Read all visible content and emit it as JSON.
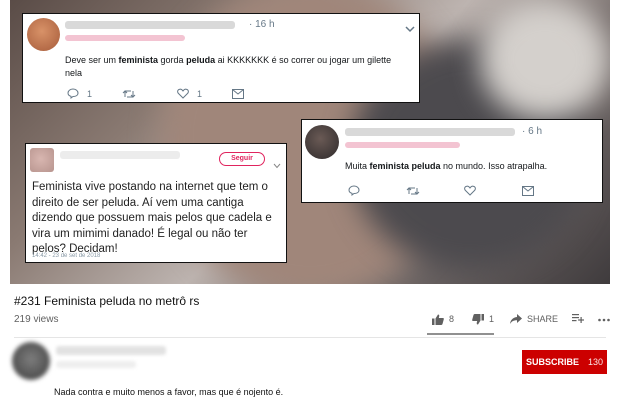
{
  "tweet1": {
    "time": "· 16 h",
    "text_prefix": "Deve ser um ",
    "bold1": "feminista",
    "text_mid1": " gorda ",
    "bold2": "peluda",
    "text_suffix": " ai KKKKKKK é so correr ou jogar um gilette",
    "text_line2": "nela",
    "reply_count": "1",
    "like_count": "1"
  },
  "tweet2": {
    "time": "· 6 h",
    "text_prefix": "Muita ",
    "bold1": "feminista peluda",
    "text_suffix": " no mundo. Isso atrapalha."
  },
  "ig_post": {
    "follow_label": "Seguir",
    "text": "Feminista vive postando na internet que tem o direito de ser peluda. Aí vem uma cantiga dizendo que possuem mais pelos que cadela e vira um mimimi danado! É legal ou não ter pelos? Decidam!",
    "timestamp": "14:42 - 23 de set de 2018"
  },
  "video": {
    "title": "#231 Feminista peluda no metrô rs",
    "views": "219 views",
    "likes": "8",
    "dislikes": "1",
    "share_label": "SHARE"
  },
  "channel": {
    "subscribe_label": "SUBSCRIBE",
    "subscriber_count": "130",
    "description": "Nada contra e muito menos a favor, mas que é nojento é."
  },
  "colors": {
    "accent_red": "#cc0000",
    "follow_pink": "#e0245e",
    "twitter_gray": "#657786"
  }
}
